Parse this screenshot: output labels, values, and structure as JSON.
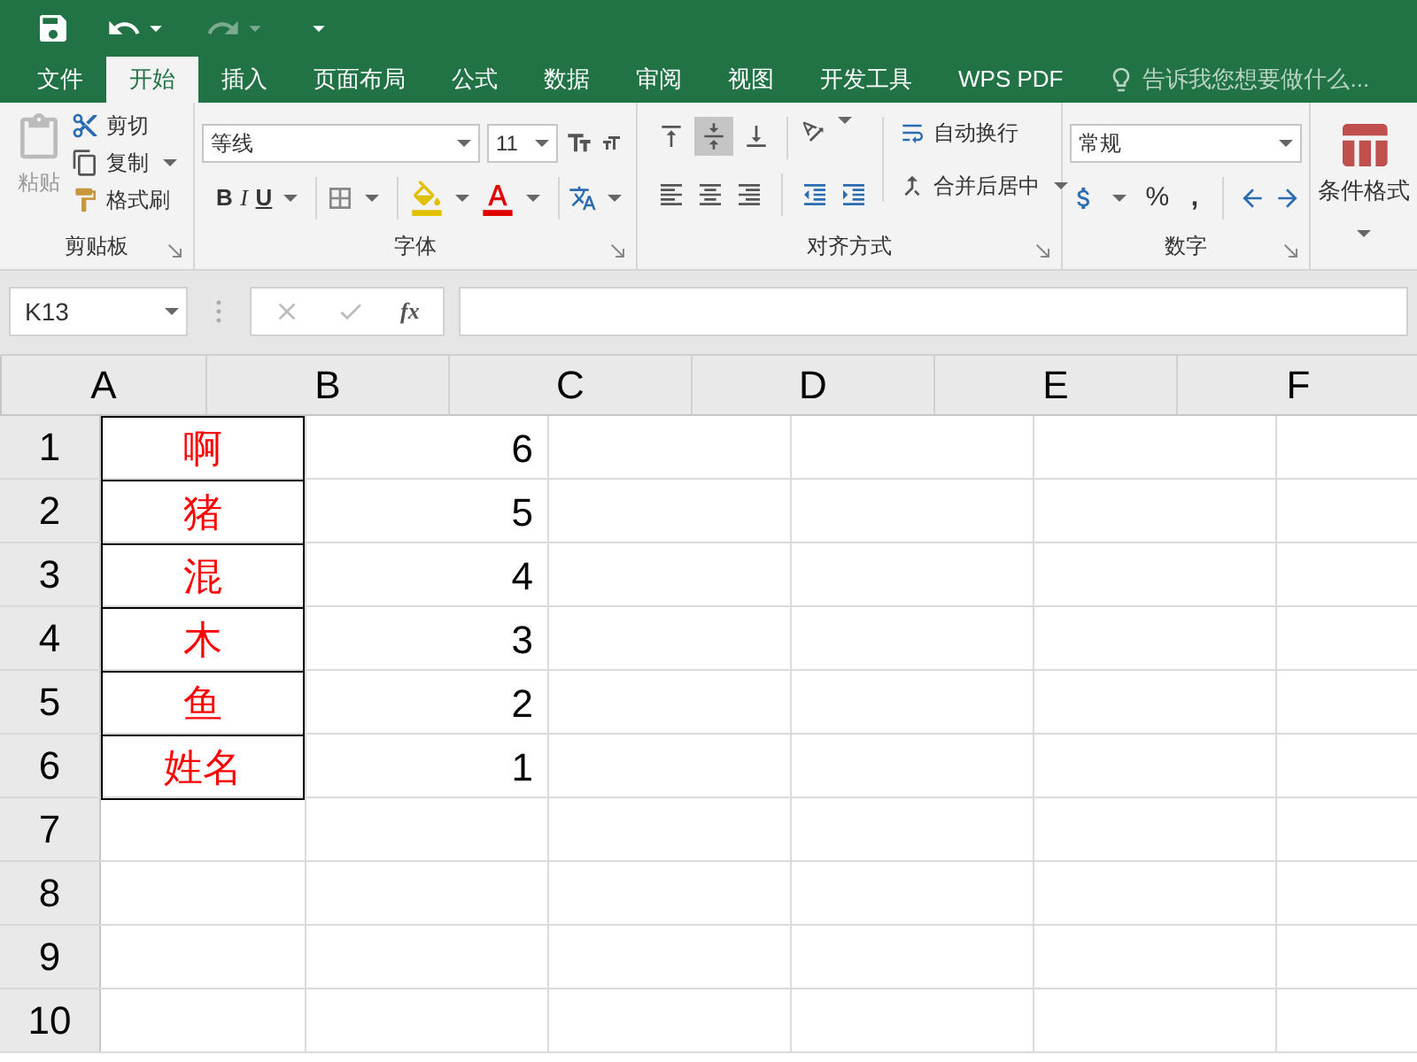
{
  "tabs": [
    {
      "label": "文件",
      "selected": false
    },
    {
      "label": "开始",
      "selected": true
    },
    {
      "label": "插入",
      "selected": false
    },
    {
      "label": "页面布局",
      "selected": false
    },
    {
      "label": "公式",
      "selected": false
    },
    {
      "label": "数据",
      "selected": false
    },
    {
      "label": "审阅",
      "selected": false
    },
    {
      "label": "视图",
      "selected": false
    },
    {
      "label": "开发工具",
      "selected": false
    },
    {
      "label": "WPS PDF",
      "selected": false
    }
  ],
  "tell_me": {
    "placeholder": "告诉我您想要做什么..."
  },
  "ribbon": {
    "clipboard": {
      "paste": "粘贴",
      "cut": "剪切",
      "copy": "复制",
      "format_painter": "格式刷",
      "label": "剪贴板"
    },
    "font": {
      "name": "等线",
      "size": "11",
      "bold": "B",
      "italic": "I",
      "underline": "U",
      "label": "字体"
    },
    "alignment": {
      "vertical": [
        {
          "selected": false
        },
        {
          "selected": true
        },
        {
          "selected": false
        }
      ],
      "wrap": "自动换行",
      "merge": "合并后居中",
      "label": "对齐方式"
    },
    "number": {
      "format": "常规",
      "percent": "%",
      "comma": ",",
      "label": "数字"
    },
    "styles": {
      "conditional": "条件格式"
    }
  },
  "formula_bar": {
    "name_box": "K13",
    "fx": "fx"
  },
  "grid": {
    "columns": [
      "A",
      "B",
      "C",
      "D",
      "E",
      "F"
    ],
    "rows": [
      {
        "header": "1",
        "cells": [
          {
            "text": "啊",
            "color": "#ff0000",
            "bordered": true
          },
          {
            "text": "6",
            "color": "#000000",
            "bordered": false
          }
        ]
      },
      {
        "header": "2",
        "cells": [
          {
            "text": "猪",
            "color": "#ff0000",
            "bordered": true
          },
          {
            "text": "5",
            "color": "#000000",
            "bordered": false
          }
        ]
      },
      {
        "header": "3",
        "cells": [
          {
            "text": "混",
            "color": "#ff0000",
            "bordered": true
          },
          {
            "text": "4",
            "color": "#000000",
            "bordered": false
          }
        ]
      },
      {
        "header": "4",
        "cells": [
          {
            "text": "木",
            "color": "#ff0000",
            "bordered": true
          },
          {
            "text": "3",
            "color": "#000000",
            "bordered": false
          }
        ]
      },
      {
        "header": "5",
        "cells": [
          {
            "text": "鱼",
            "color": "#ff0000",
            "bordered": true
          },
          {
            "text": "2",
            "color": "#000000",
            "bordered": false
          }
        ]
      },
      {
        "header": "6",
        "cells": [
          {
            "text": "姓名",
            "color": "#ff0000",
            "bordered": true
          },
          {
            "text": "1",
            "color": "#000000",
            "bordered": false
          }
        ]
      },
      {
        "header": "7",
        "cells": []
      },
      {
        "header": "8",
        "cells": []
      },
      {
        "header": "9",
        "cells": []
      },
      {
        "header": "10",
        "cells": []
      }
    ]
  }
}
